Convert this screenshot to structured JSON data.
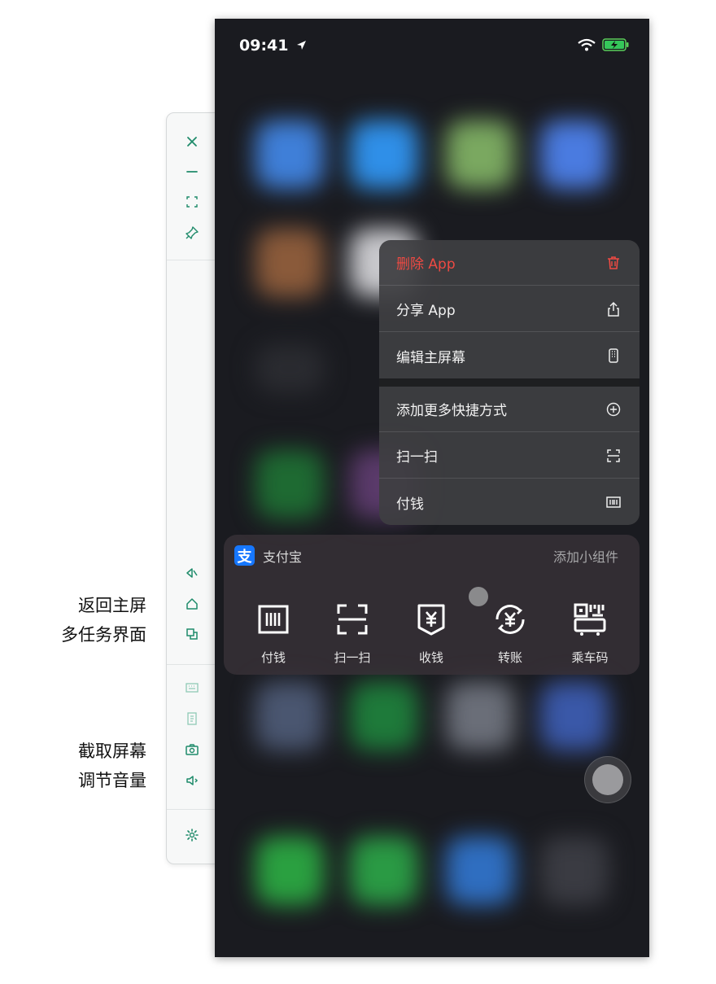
{
  "status": {
    "time": "09:41"
  },
  "menu": [
    {
      "label": "删除 App",
      "icon": "trash-icon",
      "danger": true
    },
    {
      "label": "分享 App",
      "icon": "share-icon"
    },
    {
      "label": "编辑主屏幕",
      "icon": "phone-grid-icon"
    },
    {
      "label": "添加更多快捷方式",
      "icon": "plus-circle-icon"
    },
    {
      "label": "扫一扫",
      "icon": "scan-icon"
    },
    {
      "label": "付钱",
      "icon": "barcode-icon"
    }
  ],
  "widget": {
    "app_name": "支付宝",
    "logo_glyph": "支",
    "add_label": "添加小组件",
    "actions": [
      {
        "label": "付钱",
        "icon": "barcode-icon"
      },
      {
        "label": "扫一扫",
        "icon": "scan-icon"
      },
      {
        "label": "收钱",
        "icon": "yen-receive-icon"
      },
      {
        "label": "转账",
        "icon": "yen-transfer-icon"
      },
      {
        "label": "乘车码",
        "icon": "bus-code-icon"
      }
    ]
  },
  "side_labels": {
    "home": "返回主屏",
    "multitask": "多任务界面",
    "screenshot": "截取屏幕",
    "volume": "调节音量"
  },
  "colors": {
    "accent": "#1f8b6a",
    "danger": "#ee4a43",
    "alipay": "#1677ff"
  }
}
